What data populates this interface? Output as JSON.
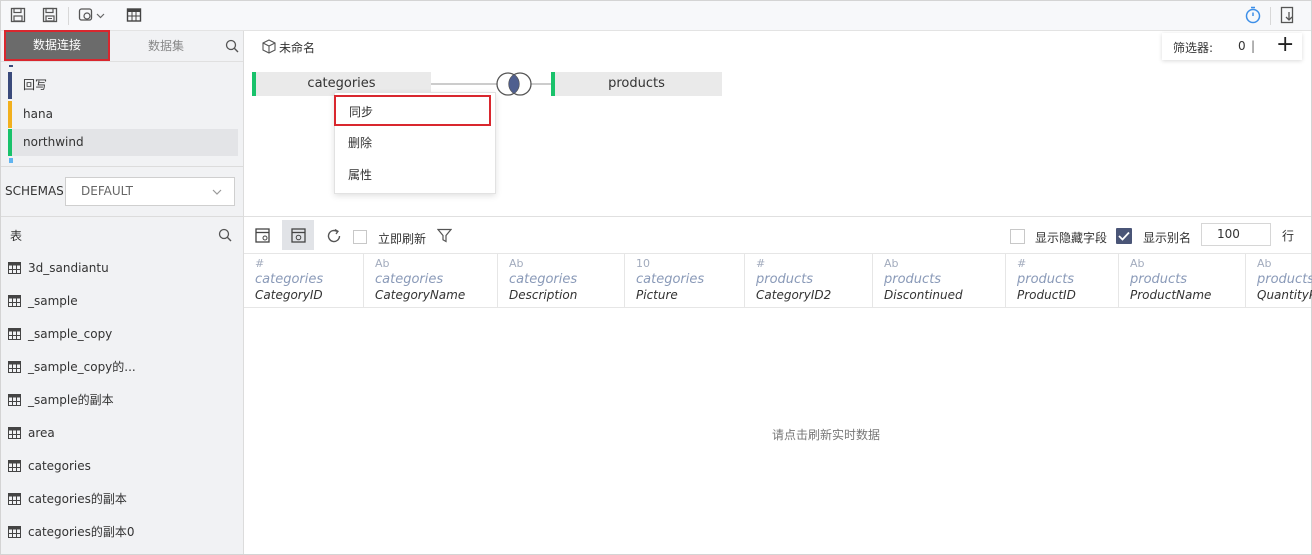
{
  "colors": {
    "accent_red": "#d9272e",
    "accent_green": "#19c26b",
    "accent_blue": "#3d8fe8"
  },
  "toolbar": {
    "icons": [
      "save-icon",
      "save-as-icon",
      "settings-icon",
      "table-icon",
      "timer-icon",
      "export-icon"
    ]
  },
  "left_panel": {
    "tabs": {
      "data_connection": "数据连接",
      "dataset": "数据集"
    },
    "connections": [
      {
        "label": "回写",
        "color": "#3a4a7b"
      },
      {
        "label": "hana",
        "color": "#f2b01e"
      },
      {
        "label": "northwind",
        "color": "#19c26b"
      }
    ],
    "schemas_label": "SCHEMAS",
    "schema_value": "DEFAULT",
    "tables_label": "表",
    "tables": [
      "3d_sandiantu",
      "_sample",
      "_sample_copy",
      "_sample_copy的...",
      "_sample的副本",
      "area",
      "categories",
      "categories的副本",
      "categories的副本0"
    ]
  },
  "canvas": {
    "title": "未命名",
    "filter_label": "筛选器:",
    "filter_count": "0",
    "filter_sep": "|",
    "add": "+",
    "left_node": "categories",
    "right_node": "products",
    "context_menu": [
      "同步",
      "删除",
      "属性"
    ]
  },
  "grid_toolbar": {
    "auto_refresh": "立即刷新",
    "show_hidden": "显示隐藏字段",
    "show_alias": "显示别名",
    "rows_value": "100",
    "rows_unit": "行"
  },
  "columns": [
    {
      "type": "#",
      "table": "categories",
      "field": "CategoryID"
    },
    {
      "type": "Ab",
      "table": "categories",
      "field": "CategoryName"
    },
    {
      "type": "Ab",
      "table": "categories",
      "field": "Description"
    },
    {
      "type": "10",
      "table": "categories",
      "field": "Picture"
    },
    {
      "type": "#",
      "table": "products",
      "field": "CategoryID2"
    },
    {
      "type": "Ab",
      "table": "products",
      "field": "Discontinued"
    },
    {
      "type": "#",
      "table": "products",
      "field": "ProductID"
    },
    {
      "type": "Ab",
      "table": "products",
      "field": "ProductName"
    },
    {
      "type": "Ab",
      "table": "products",
      "field": "QuantityPerUnit"
    }
  ],
  "empty_message": "请点击刷新实时数据"
}
